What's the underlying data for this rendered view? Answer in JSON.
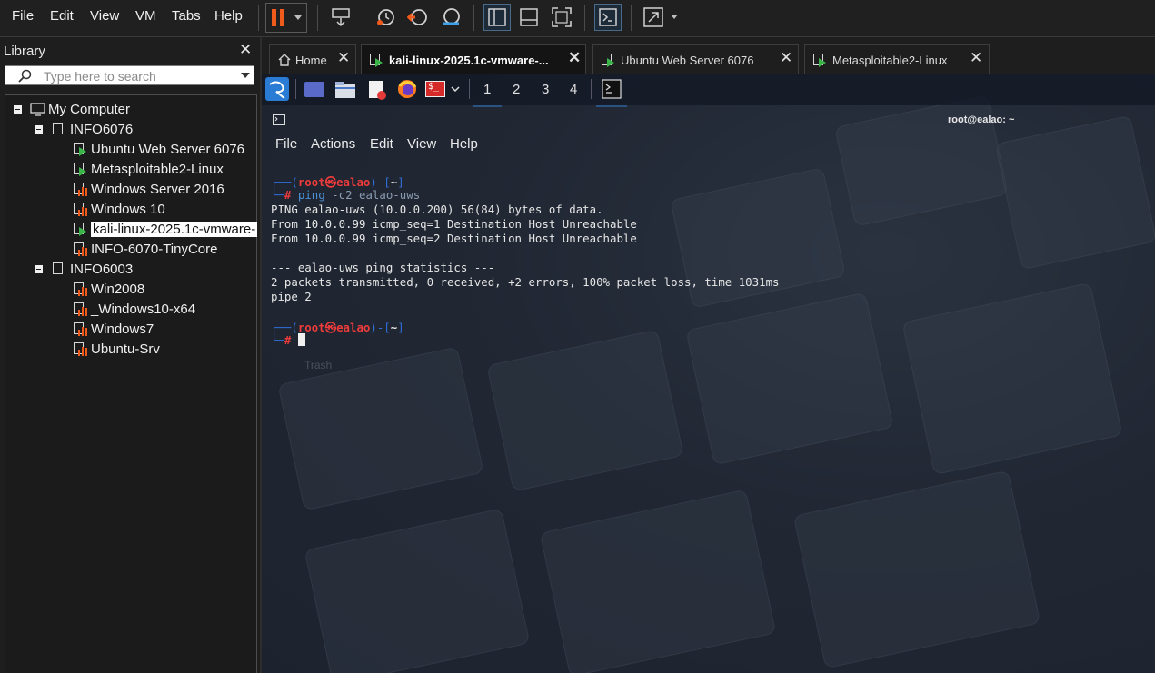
{
  "menu": [
    "File",
    "Edit",
    "View",
    "VM",
    "Tabs",
    "Help"
  ],
  "colors": {
    "pause_accent": "#f05a1a",
    "play_green": "#3bb54a",
    "stopped_orange": "#f05a1a",
    "prompt_red": "#ee3b3b",
    "prompt_blue": "#2f6fd8"
  },
  "library": {
    "title": "Library",
    "search_placeholder": "Type here to search",
    "tree": [
      {
        "label": "My Computer",
        "depth": 0,
        "icon": "computer-icon",
        "expandable": true
      },
      {
        "label": "INFO6076",
        "depth": 1,
        "icon": "folder-icon",
        "expandable": true
      },
      {
        "label": "Ubuntu Web Server 6076",
        "depth": 2,
        "icon": "vm-running-icon",
        "state": "running"
      },
      {
        "label": "Metasploitable2-Linux",
        "depth": 2,
        "icon": "vm-running-icon",
        "state": "running"
      },
      {
        "label": "Windows Server 2016",
        "depth": 2,
        "icon": "vm-stopped-icon",
        "state": "stopped"
      },
      {
        "label": "Windows 10",
        "depth": 2,
        "icon": "vm-stopped-icon",
        "state": "stopped"
      },
      {
        "label": "kali-linux-2025.1c-vmware-",
        "depth": 2,
        "icon": "vm-running-icon",
        "state": "running",
        "selected": true
      },
      {
        "label": "INFO-6070-TinyCore",
        "depth": 2,
        "icon": "vm-stopped-icon",
        "state": "stopped"
      },
      {
        "label": "INFO6003",
        "depth": 1,
        "icon": "folder-icon",
        "expandable": true
      },
      {
        "label": "Win2008",
        "depth": 2,
        "icon": "vm-stopped-icon",
        "state": "stopped"
      },
      {
        "label": "_Windows10-x64",
        "depth": 2,
        "icon": "vm-stopped-icon",
        "state": "stopped"
      },
      {
        "label": "Windows7",
        "depth": 2,
        "icon": "vm-stopped-icon",
        "state": "stopped"
      },
      {
        "label": "Ubuntu-Srv",
        "depth": 2,
        "icon": "vm-stopped-icon",
        "state": "stopped"
      }
    ]
  },
  "tabs": [
    {
      "label": "Home",
      "icon": "home-icon"
    },
    {
      "label": "kali-linux-2025.1c-vmware-...",
      "icon": "vm-running-icon",
      "active": true
    },
    {
      "label": "Ubuntu Web Server 6076",
      "icon": "vm-running-icon"
    },
    {
      "label": "Metasploitable2-Linux",
      "icon": "vm-running-icon"
    }
  ],
  "kali_panel": {
    "workspaces": [
      "1",
      "2",
      "3",
      "4"
    ],
    "active_workspace": "1"
  },
  "terminal": {
    "title": "root@ealao: ~",
    "menu": [
      "File",
      "Actions",
      "Edit",
      "View",
      "Help"
    ],
    "prompt_user": "root",
    "prompt_sep": "㉿",
    "prompt_host": "ealao",
    "prompt_dir": "~",
    "command": "ping -c2 ealao-uws",
    "cmd_name": "ping",
    "cmd_args": "-c2 ealao-uws",
    "output": [
      "PING ealao-uws (10.0.0.200) 56(84) bytes of data.",
      "From 10.0.0.99 icmp_seq=1 Destination Host Unreachable",
      "From 10.0.0.99 icmp_seq=2 Destination Host Unreachable",
      "",
      "--- ealao-uws ping statistics ---",
      "2 packets transmitted, 0 received, +2 errors, 100% packet loss, time 1031ms",
      "pipe 2"
    ],
    "faded_text": "Trash"
  }
}
